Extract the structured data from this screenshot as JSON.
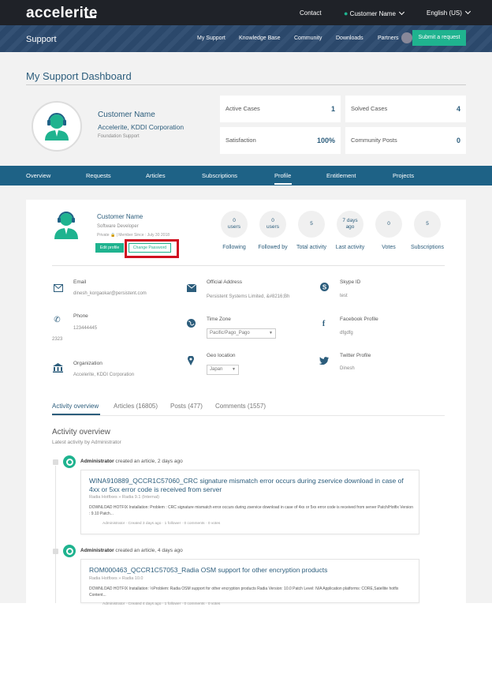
{
  "top": {
    "logo": "accelerite",
    "contact": "Contact",
    "user": "Customer Name",
    "language": "English (US)"
  },
  "nav": {
    "title": "Support",
    "links": [
      "My Support",
      "Knowledge Base",
      "Community",
      "Downloads",
      "Partners"
    ],
    "submit": "Submit a request"
  },
  "dashboard": {
    "title": "My Support Dashboard",
    "name": "Customer Name",
    "org": "Accelerite, KDDI Corporation",
    "sub": "Foundation Support",
    "stats": [
      {
        "label": "Active Cases",
        "value": "1"
      },
      {
        "label": "Solved Cases",
        "value": "4"
      },
      {
        "label": "Satisfaction",
        "value": "100%"
      },
      {
        "label": "Community Posts",
        "value": "0"
      }
    ]
  },
  "tabs": [
    "Overview",
    "Requests",
    "Articles",
    "Subscriptions",
    "Profile",
    "Entitlement",
    "Projects"
  ],
  "profile": {
    "name": "Customer Name",
    "role": "Software Developer",
    "meta": "Private 🔒 | Member Since : July 30 2018",
    "edit": "Edit profile",
    "change_password": "Change Password",
    "stats": [
      {
        "l1": "0",
        "l2": "users",
        "caption": "Following"
      },
      {
        "l1": "0",
        "l2": "users",
        "caption": "Followed by"
      },
      {
        "l1": "5",
        "l2": "",
        "caption": "Total activity"
      },
      {
        "l1": "7 days",
        "l2": "ago",
        "caption": "Last activity"
      },
      {
        "l1": "0",
        "l2": "",
        "caption": "Votes"
      },
      {
        "l1": "5",
        "l2": "",
        "caption": "Subscriptions"
      }
    ],
    "fields": {
      "email": {
        "label": "Email",
        "value": "dinesh_korgaokar@persistent.com"
      },
      "phone": {
        "label": "Phone",
        "value": "123444445",
        "value2": "2323"
      },
      "organization": {
        "label": "Organization",
        "value": "Accelerite, KDDI Corporation"
      },
      "address": {
        "label": "Official Address",
        "value": "Persistent Systems Limited, &#8216;Bh"
      },
      "timezone": {
        "label": "Time Zone",
        "value": "Pacific/Pago_Pago"
      },
      "geo": {
        "label": "Geo location",
        "value": "Japan"
      },
      "skype": {
        "label": "Skype ID",
        "value": "test"
      },
      "facebook": {
        "label": "Facebook Profile",
        "value": "dfgdfg"
      },
      "twitter": {
        "label": "Twitter Profile",
        "value": "Dinesh"
      }
    }
  },
  "activity": {
    "tabs": [
      "Activity overview",
      "Articles (16805)",
      "Posts (477)",
      "Comments (1557)"
    ],
    "title": "Activity overview",
    "subtitle": "Latest activity by Administrator",
    "items": [
      {
        "author": "Administrator",
        "action": " created an article, 2 days ago",
        "title": "WINA910889_QCCR1C57060_CRC signature mismatch error occurs during zservice download in case of 4xx or 5xx error code is received from server",
        "bread": "Radia Hotfixes  » Radia 9.1 (Internal)",
        "body": "DOWNLOAD HOTFIX  Installation: Problem : CRC signature mismatch error occurs during zservice download in case of 4xx or 5xx error code is received from server Patch/Hotfix Version : 9.10 Patch...",
        "foot": "Administrator · Created 3 days ago · 1 follower · 0 comments · 0 votes"
      },
      {
        "author": "Administrator",
        "action": " created an article, 4 days ago",
        "title": "ROM000463_QCCR1C57053_Radia OSM support for other encryption products",
        "bread": "Radia Hotfixes  » Radia 10.0",
        "body": "DOWNLOAD HOTFIX  Installation: ½Problem: Radia OSM support for other encryption products Radia Version: 10.0 Patch Level: N/A Application platforms: CORE,Satellite hotfix Content...",
        "foot": "Administrator · Created 4 days ago · 1 follower · 0 comments · 0 votes"
      }
    ]
  },
  "colors": {
    "accent": "#1fb38f",
    "nav": "#2c4a6e",
    "tabbar": "#1e6286",
    "link": "#2c5d7c",
    "highlight": "#d01020"
  }
}
